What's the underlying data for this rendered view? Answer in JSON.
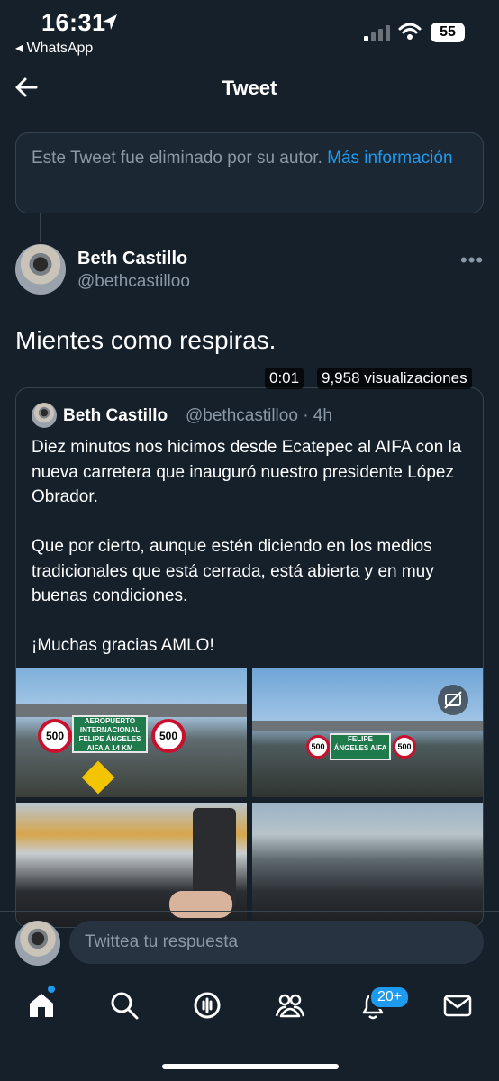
{
  "status_bar": {
    "time": "16:31",
    "back_app": "◂ WhatsApp",
    "battery": "55"
  },
  "header": {
    "title": "Tweet"
  },
  "deleted_notice": {
    "text": "Este Tweet fue eliminado por su autor. ",
    "link": "Más información"
  },
  "tweet": {
    "author_name": "Beth Castillo",
    "author_handle": "@bethcastilloo",
    "text": "Mientes como respiras."
  },
  "quoted_tweet": {
    "author_name": "Beth Castillo",
    "meta": "@bethcastilloo · 4h",
    "body": "Diez minutos nos hicimos desde Ecatepec al AIFA con la nueva carretera que inauguró nuestro presidente López Obrador.\n\nQue por cierto, aunque estén diciendo en los medios tradicionales que está cerrada, está abierta y en muy buenas condiciones.\n\n¡Muchas gracias AMLO!",
    "video_time": "0:01",
    "video_views": "9,958 visualizaciones",
    "sign_text": "AEROPUERTO INTERNACIONAL FELIPE ÁNGELES AIFA A 14 KM",
    "sign_short": "FELIPE ÁNGELES AIFA",
    "speed_limit": "500"
  },
  "reply": {
    "placeholder": "Twittea tu respuesta"
  },
  "nav": {
    "notifications_badge": "20+"
  },
  "colors": {
    "background": "#15202b",
    "accent": "#1d9bf0",
    "muted": "#8b98a5",
    "border": "#38444d"
  }
}
